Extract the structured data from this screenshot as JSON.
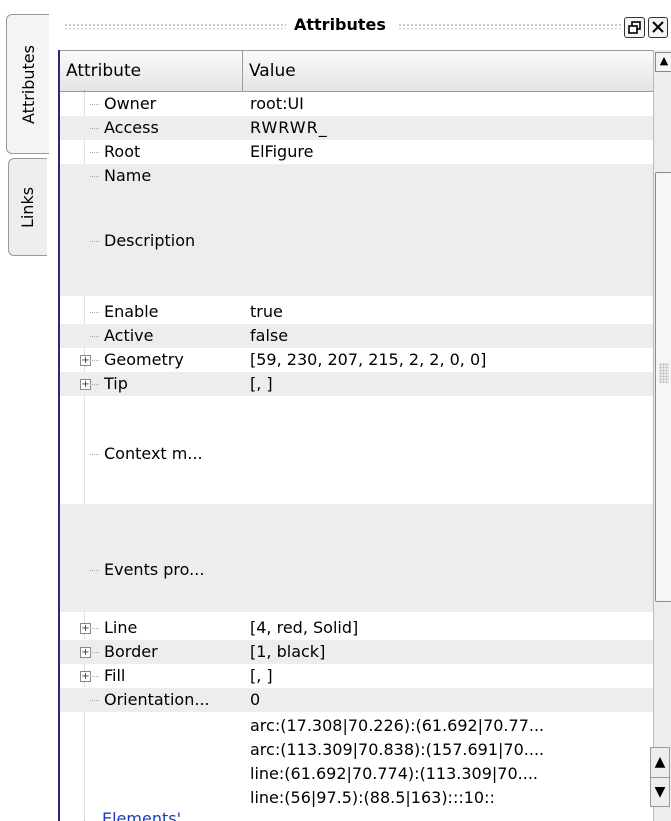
{
  "tabs": {
    "attributes": "Attributes",
    "links": "Links"
  },
  "dock": {
    "title": "Attributes",
    "float_icon": "float-icon",
    "close_icon": "close-icon"
  },
  "table": {
    "headers": [
      "Attribute",
      "Value"
    ],
    "rows": [
      {
        "name": "Owner",
        "value": "root:UI",
        "expandable": false
      },
      {
        "name": "Access",
        "value": "RWRWR_",
        "expandable": false
      },
      {
        "name": "Root",
        "value": "ElFigure",
        "expandable": false
      },
      {
        "name": "Name",
        "value": "",
        "expandable": false
      },
      {
        "name": "Description",
        "value": "",
        "expandable": false
      },
      {
        "name": "Enable",
        "value": "true",
        "expandable": false
      },
      {
        "name": "Active",
        "value": "false",
        "expandable": false
      },
      {
        "name": "Geometry",
        "value": "[59, 230, 207, 215, 2, 2, 0, 0]",
        "expandable": true
      },
      {
        "name": "Tip",
        "value": "[, ]",
        "expandable": true
      },
      {
        "name": "Context m...",
        "value": "",
        "expandable": false
      },
      {
        "name": "Events pro...",
        "value": "",
        "expandable": false
      },
      {
        "name": "Line",
        "value": "[4, red, Solid]",
        "expandable": true
      },
      {
        "name": "Border",
        "value": "[1, black]",
        "expandable": true
      },
      {
        "name": "Fill",
        "value": "[, ]",
        "expandable": true
      },
      {
        "name": "Orientation...",
        "value": "0",
        "expandable": false
      },
      {
        "name": "Elements'...",
        "value": "",
        "expandable": false
      }
    ],
    "elements_lines": [
      "arc:(17.308|70.226):(61.692|70.77...",
      "arc:(113.309|70.838):(157.691|70....",
      "line:(61.692|70.774):(113.309|70....",
      "line:(56|97.5):(88.5|163):::10::"
    ]
  }
}
